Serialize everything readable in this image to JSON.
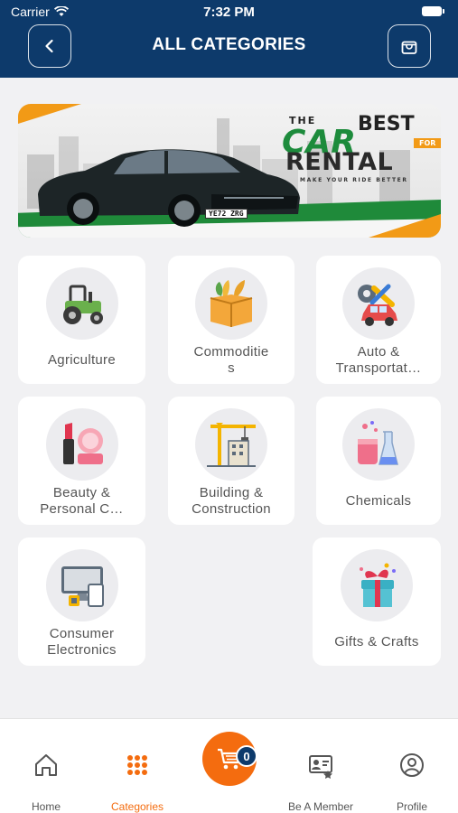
{
  "status_bar": {
    "carrier": "Carrier",
    "time": "7:32 PM"
  },
  "header": {
    "title": "ALL CATEGORIES"
  },
  "banner": {
    "the": "THE",
    "best": "BEST",
    "car": "CAR",
    "for": "FOR",
    "rental": "RENTAL",
    "tagline": "MAKE YOUR RIDE BETTER",
    "plate": "YE72 ZRG"
  },
  "categories": [
    {
      "label": "Agriculture",
      "icon": "tractor-icon"
    },
    {
      "label": "Commoditie\ns",
      "icon": "crate-icon"
    },
    {
      "label": "Auto &\nTransportat…",
      "icon": "car-repair-icon"
    },
    {
      "label": "Beauty &\nPersonal C…",
      "icon": "cosmetics-icon"
    },
    {
      "label": "Building &\nConstruction",
      "icon": "crane-icon"
    },
    {
      "label": "Chemicals",
      "icon": "flask-icon"
    },
    {
      "label": "Consumer\nElectronics",
      "icon": "devices-icon"
    },
    {
      "label": "Gifts & Crafts",
      "icon": "gift-icon"
    }
  ],
  "tabbar": {
    "home": "Home",
    "categories": "Categories",
    "member": "Be A Member",
    "profile": "Profile",
    "cart_count": "0"
  },
  "colors": {
    "primary": "#0d3a6b",
    "accent": "#f46c0f"
  }
}
